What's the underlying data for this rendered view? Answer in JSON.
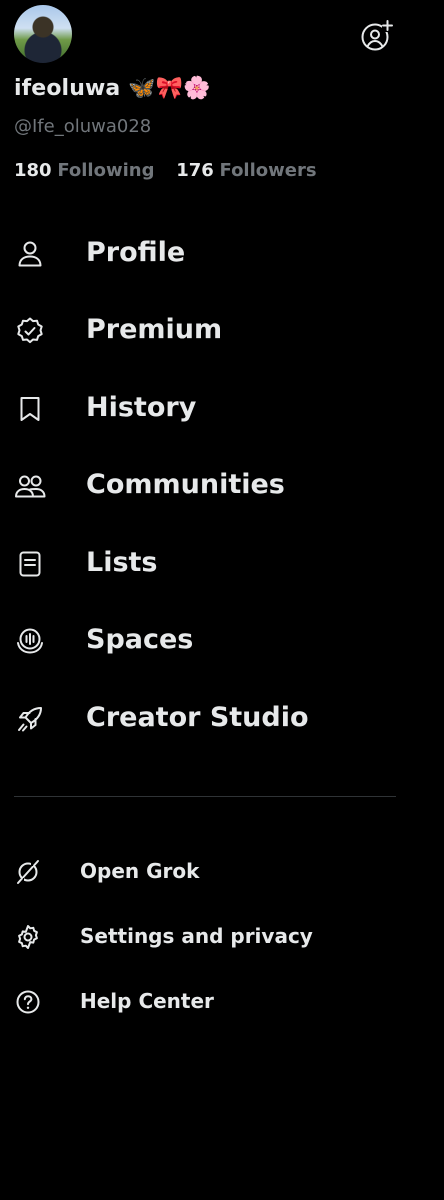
{
  "profile": {
    "display_name": "ifeoluwa 🦋🎀🌸",
    "handle": "@Ife_oluwa028",
    "following_count": "180",
    "following_label": "Following",
    "followers_count": "176",
    "followers_label": "Followers"
  },
  "menu": [
    {
      "label": "Profile",
      "icon": "person-icon"
    },
    {
      "label": "Premium",
      "icon": "verified-badge-icon"
    },
    {
      "label": "History",
      "icon": "bookmark-icon"
    },
    {
      "label": "Communities",
      "icon": "people-icon"
    },
    {
      "label": "Lists",
      "icon": "list-icon"
    },
    {
      "label": "Spaces",
      "icon": "microphone-icon"
    },
    {
      "label": "Creator Studio",
      "icon": "rocket-icon"
    }
  ],
  "secondary": [
    {
      "label": "Open Grok",
      "icon": "grok-icon"
    },
    {
      "label": "Settings and privacy",
      "icon": "gear-icon"
    },
    {
      "label": "Help Center",
      "icon": "question-circle-icon"
    }
  ],
  "colors": {
    "background": "#000000",
    "text": "#e7e9ea",
    "secondary_text": "#71767b",
    "divider": "#2f3336"
  }
}
